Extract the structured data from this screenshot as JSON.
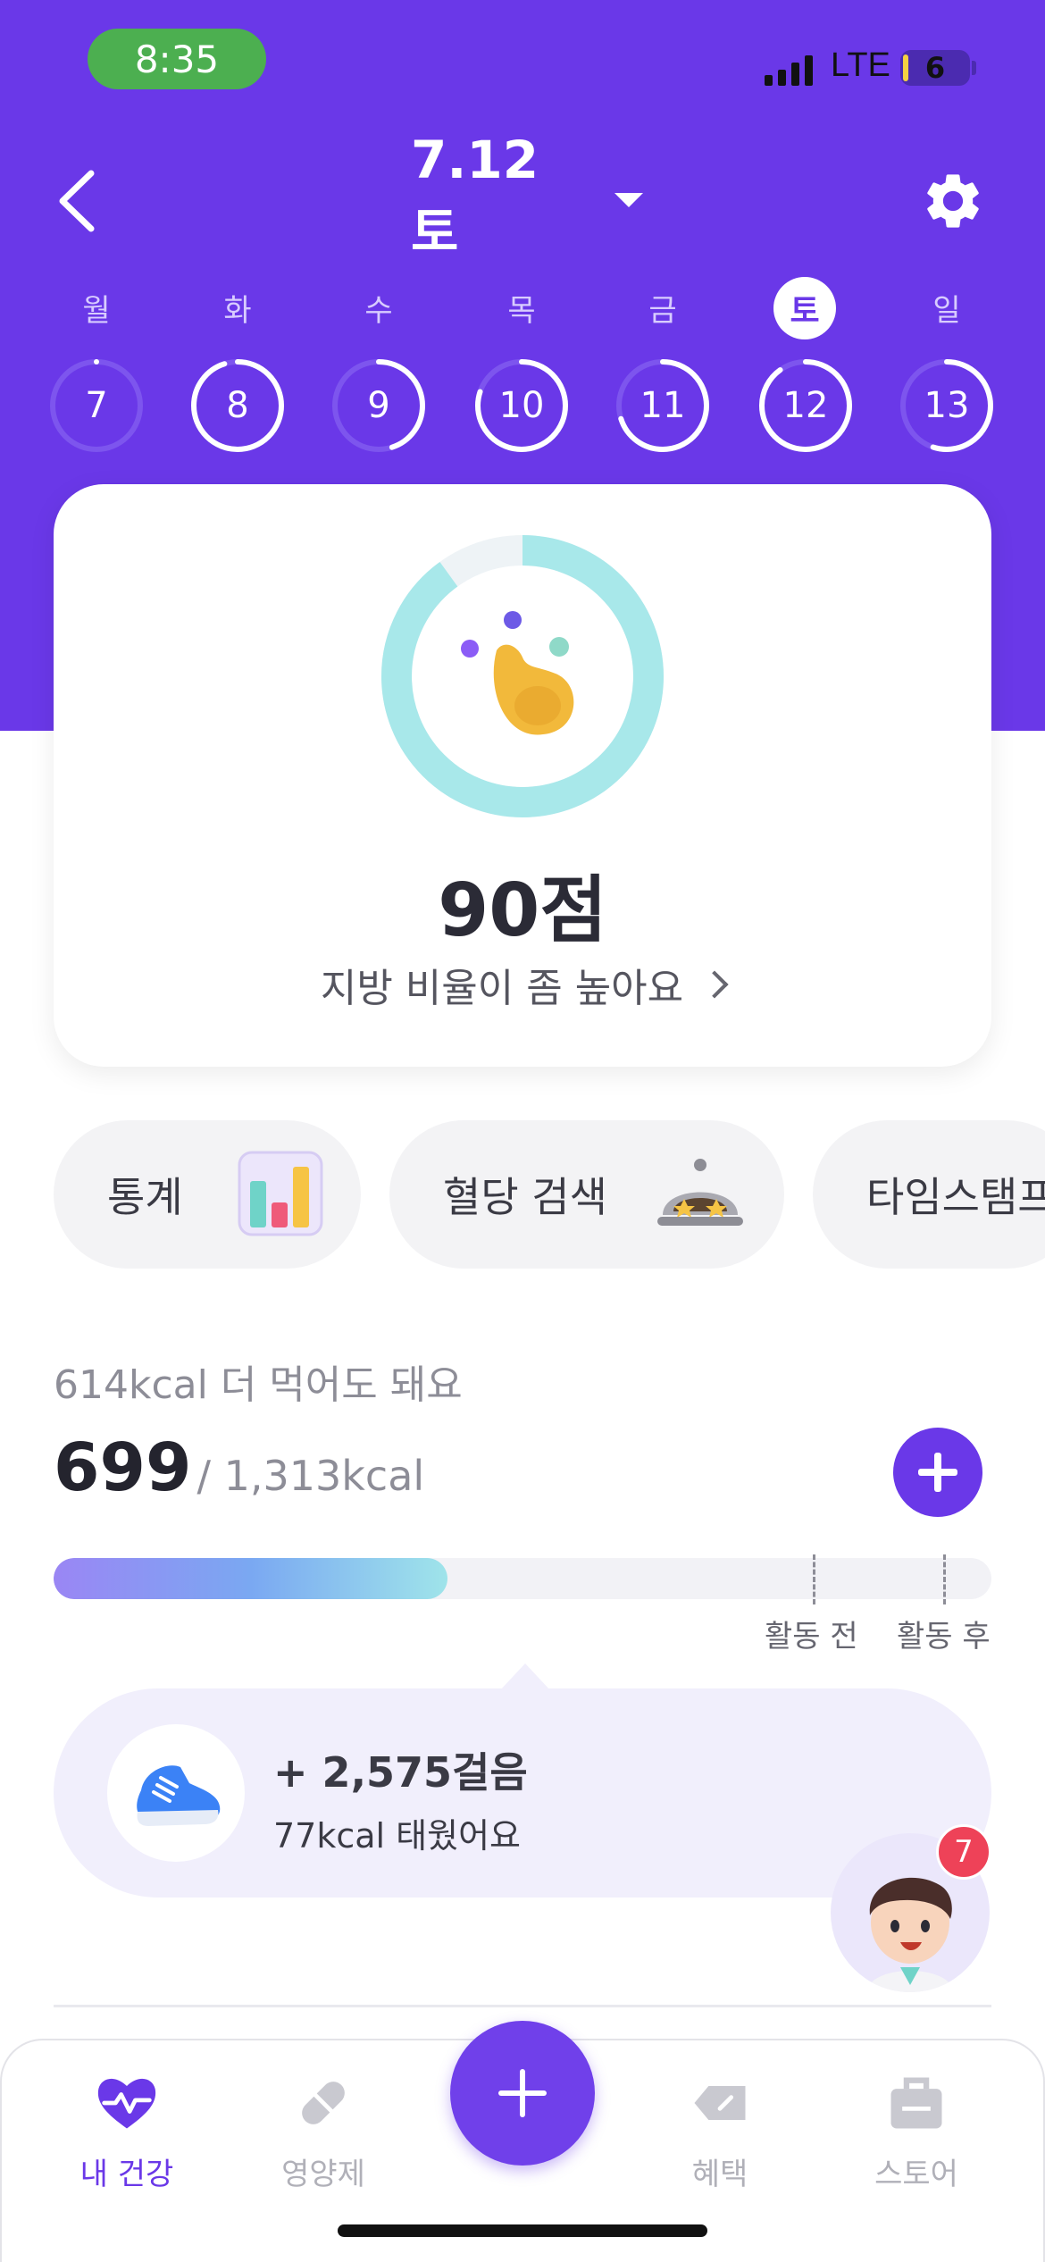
{
  "status_bar": {
    "time": "8:35",
    "network": "LTE",
    "battery": "6"
  },
  "header": {
    "date": "7.12 토"
  },
  "week": {
    "labels": [
      "월",
      "화",
      "수",
      "목",
      "금",
      "토",
      "일"
    ],
    "days": [
      "7",
      "8",
      "9",
      "10",
      "11",
      "12",
      "13"
    ],
    "progress": [
      0.0,
      0.95,
      0.45,
      0.8,
      0.7,
      0.9,
      0.55
    ],
    "selected_index": 5
  },
  "score": {
    "value": "90점",
    "description": "지방 비율이 좀 높아요",
    "progress": 0.9
  },
  "chips": [
    {
      "label": "통계",
      "icon": "bar-chart-icon"
    },
    {
      "label": "혈당 검색",
      "icon": "food-dome-icon"
    },
    {
      "label": "타임스탬프",
      "icon": "clock-icon"
    }
  ],
  "calories": {
    "note": "614kcal 더 먹어도 돼요",
    "eaten": "699",
    "total": "/ 1,313kcal",
    "progress": 0.42,
    "before_activity_label": "활동 전",
    "after_activity_label": "활동 후"
  },
  "steps": {
    "count": "+ 2,575걸음",
    "burned": "77kcal 태웠어요"
  },
  "assistant": {
    "badge": "7"
  },
  "tabs": [
    {
      "label": "내 건강",
      "icon": "heart-pulse-icon",
      "active": true
    },
    {
      "label": "영양제",
      "icon": "pill-icon",
      "active": false
    },
    {
      "label": "혜택",
      "icon": "tag-icon",
      "active": false
    },
    {
      "label": "스토어",
      "icon": "bag-icon",
      "active": false
    }
  ],
  "colors": {
    "primary": "#6a38e8",
    "ring": "#a8e8ea",
    "badge": "#ee4258"
  }
}
